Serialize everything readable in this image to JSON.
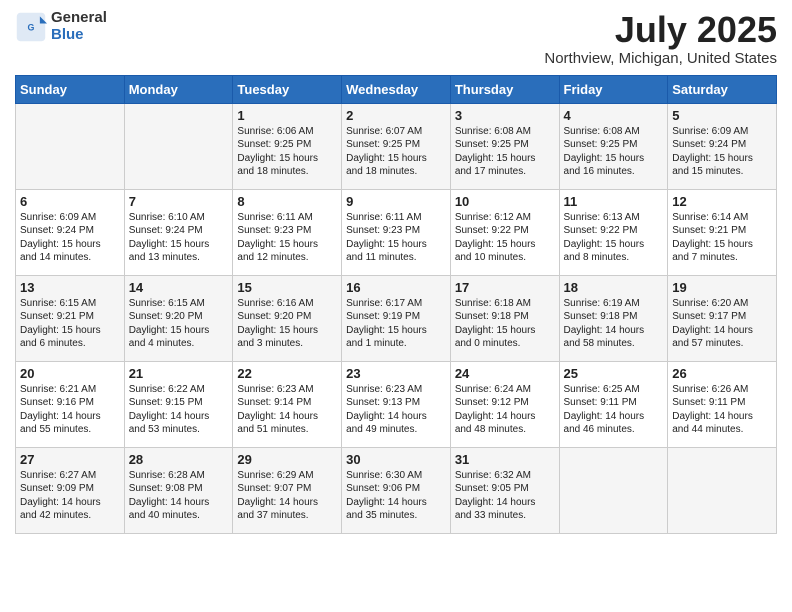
{
  "logo": {
    "general": "General",
    "blue": "Blue"
  },
  "title": {
    "month_year": "July 2025",
    "location": "Northview, Michigan, United States"
  },
  "header": {
    "days": [
      "Sunday",
      "Monday",
      "Tuesday",
      "Wednesday",
      "Thursday",
      "Friday",
      "Saturday"
    ]
  },
  "weeks": [
    [
      {
        "day": "",
        "info": ""
      },
      {
        "day": "",
        "info": ""
      },
      {
        "day": "1",
        "info": "Sunrise: 6:06 AM\nSunset: 9:25 PM\nDaylight: 15 hours\nand 18 minutes."
      },
      {
        "day": "2",
        "info": "Sunrise: 6:07 AM\nSunset: 9:25 PM\nDaylight: 15 hours\nand 18 minutes."
      },
      {
        "day": "3",
        "info": "Sunrise: 6:08 AM\nSunset: 9:25 PM\nDaylight: 15 hours\nand 17 minutes."
      },
      {
        "day": "4",
        "info": "Sunrise: 6:08 AM\nSunset: 9:25 PM\nDaylight: 15 hours\nand 16 minutes."
      },
      {
        "day": "5",
        "info": "Sunrise: 6:09 AM\nSunset: 9:24 PM\nDaylight: 15 hours\nand 15 minutes."
      }
    ],
    [
      {
        "day": "6",
        "info": "Sunrise: 6:09 AM\nSunset: 9:24 PM\nDaylight: 15 hours\nand 14 minutes."
      },
      {
        "day": "7",
        "info": "Sunrise: 6:10 AM\nSunset: 9:24 PM\nDaylight: 15 hours\nand 13 minutes."
      },
      {
        "day": "8",
        "info": "Sunrise: 6:11 AM\nSunset: 9:23 PM\nDaylight: 15 hours\nand 12 minutes."
      },
      {
        "day": "9",
        "info": "Sunrise: 6:11 AM\nSunset: 9:23 PM\nDaylight: 15 hours\nand 11 minutes."
      },
      {
        "day": "10",
        "info": "Sunrise: 6:12 AM\nSunset: 9:22 PM\nDaylight: 15 hours\nand 10 minutes."
      },
      {
        "day": "11",
        "info": "Sunrise: 6:13 AM\nSunset: 9:22 PM\nDaylight: 15 hours\nand 8 minutes."
      },
      {
        "day": "12",
        "info": "Sunrise: 6:14 AM\nSunset: 9:21 PM\nDaylight: 15 hours\nand 7 minutes."
      }
    ],
    [
      {
        "day": "13",
        "info": "Sunrise: 6:15 AM\nSunset: 9:21 PM\nDaylight: 15 hours\nand 6 minutes."
      },
      {
        "day": "14",
        "info": "Sunrise: 6:15 AM\nSunset: 9:20 PM\nDaylight: 15 hours\nand 4 minutes."
      },
      {
        "day": "15",
        "info": "Sunrise: 6:16 AM\nSunset: 9:20 PM\nDaylight: 15 hours\nand 3 minutes."
      },
      {
        "day": "16",
        "info": "Sunrise: 6:17 AM\nSunset: 9:19 PM\nDaylight: 15 hours\nand 1 minute."
      },
      {
        "day": "17",
        "info": "Sunrise: 6:18 AM\nSunset: 9:18 PM\nDaylight: 15 hours\nand 0 minutes."
      },
      {
        "day": "18",
        "info": "Sunrise: 6:19 AM\nSunset: 9:18 PM\nDaylight: 14 hours\nand 58 minutes."
      },
      {
        "day": "19",
        "info": "Sunrise: 6:20 AM\nSunset: 9:17 PM\nDaylight: 14 hours\nand 57 minutes."
      }
    ],
    [
      {
        "day": "20",
        "info": "Sunrise: 6:21 AM\nSunset: 9:16 PM\nDaylight: 14 hours\nand 55 minutes."
      },
      {
        "day": "21",
        "info": "Sunrise: 6:22 AM\nSunset: 9:15 PM\nDaylight: 14 hours\nand 53 minutes."
      },
      {
        "day": "22",
        "info": "Sunrise: 6:23 AM\nSunset: 9:14 PM\nDaylight: 14 hours\nand 51 minutes."
      },
      {
        "day": "23",
        "info": "Sunrise: 6:23 AM\nSunset: 9:13 PM\nDaylight: 14 hours\nand 49 minutes."
      },
      {
        "day": "24",
        "info": "Sunrise: 6:24 AM\nSunset: 9:12 PM\nDaylight: 14 hours\nand 48 minutes."
      },
      {
        "day": "25",
        "info": "Sunrise: 6:25 AM\nSunset: 9:11 PM\nDaylight: 14 hours\nand 46 minutes."
      },
      {
        "day": "26",
        "info": "Sunrise: 6:26 AM\nSunset: 9:11 PM\nDaylight: 14 hours\nand 44 minutes."
      }
    ],
    [
      {
        "day": "27",
        "info": "Sunrise: 6:27 AM\nSunset: 9:09 PM\nDaylight: 14 hours\nand 42 minutes."
      },
      {
        "day": "28",
        "info": "Sunrise: 6:28 AM\nSunset: 9:08 PM\nDaylight: 14 hours\nand 40 minutes."
      },
      {
        "day": "29",
        "info": "Sunrise: 6:29 AM\nSunset: 9:07 PM\nDaylight: 14 hours\nand 37 minutes."
      },
      {
        "day": "30",
        "info": "Sunrise: 6:30 AM\nSunset: 9:06 PM\nDaylight: 14 hours\nand 35 minutes."
      },
      {
        "day": "31",
        "info": "Sunrise: 6:32 AM\nSunset: 9:05 PM\nDaylight: 14 hours\nand 33 minutes."
      },
      {
        "day": "",
        "info": ""
      },
      {
        "day": "",
        "info": ""
      }
    ]
  ]
}
